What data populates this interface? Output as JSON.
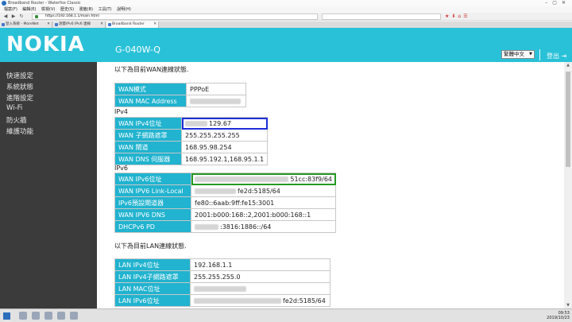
{
  "window": {
    "title": "Broadband Router - Waterfox Classic"
  },
  "menu": [
    "檔案(F)",
    "編輯(E)",
    "檢視(V)",
    "歷史(S)",
    "書籤(B)",
    "工具(T)",
    "說明(H)"
  ],
  "url": "https://192.168.1.1/main.html",
  "tabs": [
    {
      "label": "登入系統 - MoreNet"
    },
    {
      "label": "測量IPv6 IPv6 連線"
    },
    {
      "label": "Broadband Router"
    }
  ],
  "header": {
    "logo": "NOKIA",
    "model": "G-040W-Q",
    "language": "繁體中文",
    "logout": "登出"
  },
  "sidebar": [
    "快速設定",
    "系統狀態",
    "進階設定",
    "Wi-Fi",
    "防火牆",
    "維護功能"
  ],
  "wan": {
    "heading": "以下為目前WAN連線狀態.",
    "general": [
      {
        "label": "WAN模式",
        "value": "PPPoE"
      },
      {
        "label": "WAN MAC Address",
        "value": ""
      }
    ],
    "ipv4_title": "IPv4",
    "ipv4": [
      {
        "label": "WAN IPv4位址",
        "value": "129.67"
      },
      {
        "label": "WAN 子網路遮罩",
        "value": "255.255.255.255"
      },
      {
        "label": "WAN 閘道",
        "value": "168.95.98.254"
      },
      {
        "label": "WAN DNS 伺服器",
        "value": "168.95.192.1,168.95.1.1"
      }
    ],
    "ipv6_title": "IPv6",
    "ipv6": [
      {
        "label": "WAN IPv6位址",
        "value": "51cc:83f9/64"
      },
      {
        "label": "WAN IPV6 Link-Local",
        "value": "fe2d:5185/64"
      },
      {
        "label": "IPv6預設閘道器",
        "value": "fe80::6aab:9ff:fe15:3001"
      },
      {
        "label": "WAN IPV6 DNS",
        "value": "2001:b000:168::2,2001:b000:168::1"
      },
      {
        "label": "DHCPv6 PD",
        "value": ":3816:1886::/64"
      }
    ]
  },
  "lan": {
    "heading": "以下為目前LAN連線狀態.",
    "rows": [
      {
        "label": "LAN IPv4位址",
        "value": "192.168.1.1"
      },
      {
        "label": "LAN IPv4子網路遮罩",
        "value": "255.255.255.0"
      },
      {
        "label": "LAN MAC位址",
        "value": ""
      },
      {
        "label": "LAN IPv6位址",
        "value": "fe2d:5185/64"
      }
    ]
  },
  "taskbar": {
    "time": "09:53",
    "date": "2019/10/23"
  },
  "colors": {
    "header": "#29c1d8",
    "key_cell": "#21b3cf",
    "sidebar": "#3b3b3b",
    "highlight_ipv4": "#1f2fd8",
    "highlight_ipv6": "#249a24"
  }
}
